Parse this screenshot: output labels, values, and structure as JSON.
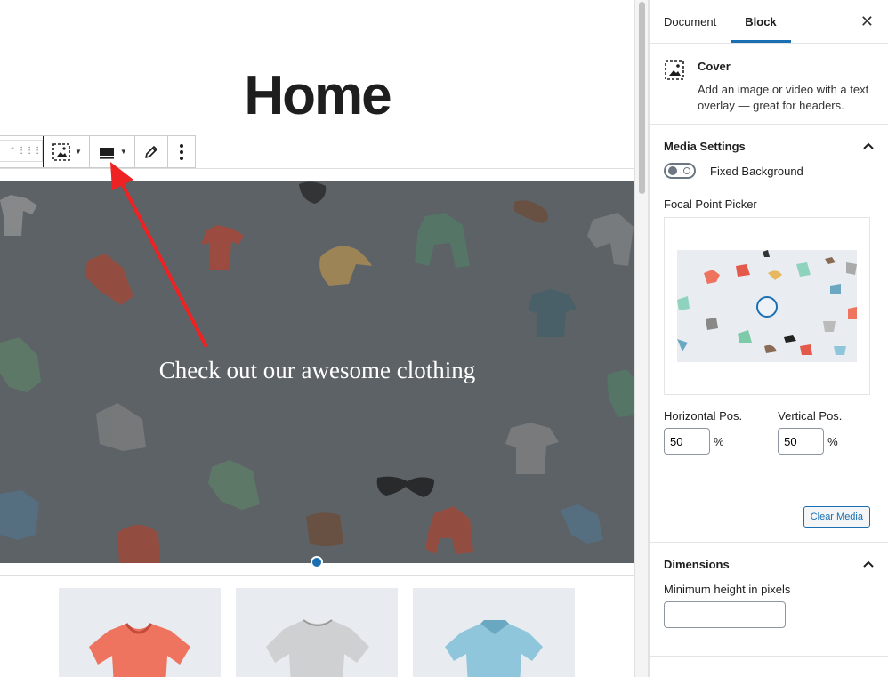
{
  "editor": {
    "post_title": "Home",
    "cover_text": "Check out our awesome clothing",
    "cover_overlay_color": "#5d6266",
    "accent_color": "#1a6fb3"
  },
  "toolbar": {
    "buttons": [
      "mover-up",
      "drag-handle",
      "change-block-type",
      "change-alignment",
      "edit-media",
      "more-options"
    ]
  },
  "sidebar": {
    "tabs": [
      "Document",
      "Block"
    ],
    "active_tab": "Block",
    "close": "✕",
    "block": {
      "name": "Cover",
      "description": "Add an image or video with a text overlay — great for headers."
    },
    "media_settings": {
      "heading": "Media Settings",
      "fixed_background_label": "Fixed Background",
      "focal_point_label": "Focal Point Picker",
      "horizontal_label": "Horizontal Pos.",
      "horizontal_value": "50",
      "vertical_label": "Vertical Pos.",
      "vertical_value": "50",
      "unit": "%",
      "clear_media": "Clear Media"
    },
    "dimensions": {
      "heading": "Dimensions",
      "min_height_label": "Minimum height in pixels",
      "min_height_value": ""
    }
  }
}
